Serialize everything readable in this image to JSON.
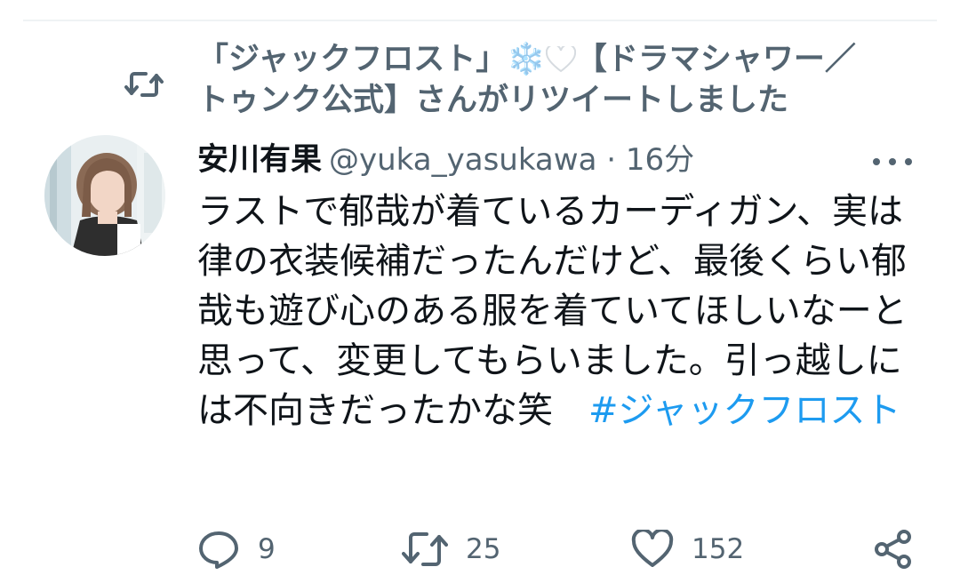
{
  "retweet_context": {
    "line1_name": "「ジャックフロスト」",
    "snowflake": "❄️",
    "line1_rest": "【ドラマシャワー／",
    "line2": "トゥンク公式】さんがリツイートしました",
    "icon": "retweet-icon"
  },
  "tweet": {
    "display_name": "安川有果",
    "handle_time": "@yuka_yasukawa · 16分",
    "text": "ラストで郁哉が着ているカーディガン、実は律の衣装候補だったんだけど、最後くらい郁哉も遊び心のある服を着ていてほしいなーと思って、変更してもらいました。引っ越しには不向きだったかな笑　",
    "hashtag": "#ジャックフロスト"
  },
  "actions": {
    "reply_count": "9",
    "retweet_count": "25",
    "like_count": "152",
    "icons": [
      "reply-icon",
      "retweet-icon",
      "like-icon",
      "share-icon"
    ]
  },
  "colors": {
    "text_primary": "#0f1419",
    "text_secondary": "#536471",
    "accent": "#1d9bf0"
  }
}
